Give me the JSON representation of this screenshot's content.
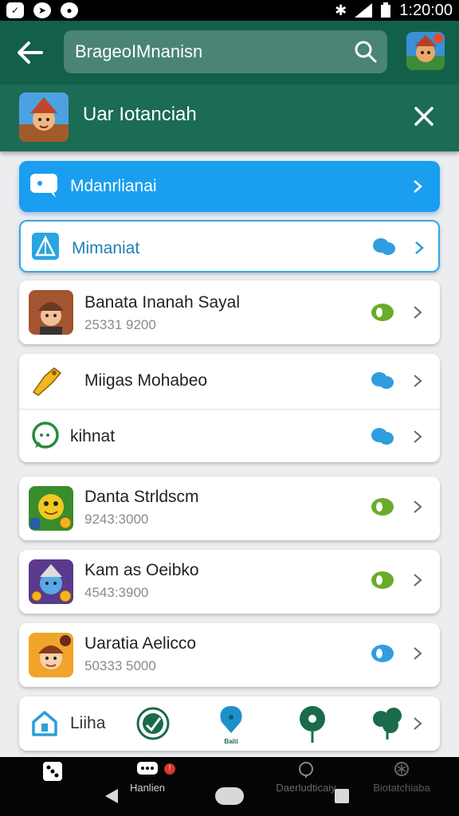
{
  "status_bar": {
    "time": "1:20:00"
  },
  "app_bar": {
    "search_text": "BrageoIMnanisn"
  },
  "sub_bar": {
    "title": "Uar Iotanciah"
  },
  "rows": [
    {
      "title": "Mdanrlianai"
    },
    {
      "title": "Mimaniat"
    },
    {
      "title": "Banata Inanah Sayal",
      "subtitle": "25331 9200"
    },
    {
      "title": "Miigas Mohabeo"
    },
    {
      "title": "kihnat"
    },
    {
      "title": "Danta Strldscm",
      "subtitle": "9243:3000"
    },
    {
      "title": "Kam as Oeibko",
      "subtitle": "4543:3900"
    },
    {
      "title": "Uaratia Aelicco",
      "subtitle": "50333 5000"
    },
    {
      "title": "Liiha"
    }
  ],
  "bottom_row_icon_caption": "Baiti",
  "bottom_nav": [
    {
      "label": "",
      "icon": "dice-icon"
    },
    {
      "label": "Hanlien",
      "icon": "chat-icon",
      "badge": "!"
    },
    {
      "label": "Daerludticaiy",
      "icon": "globe-icon"
    },
    {
      "label": "Biotatchiaba",
      "icon": "settings-icon"
    }
  ],
  "colors": {
    "app_bar": "#13604a",
    "sub_bar": "#1b6b55",
    "accent_blue": "#1a9ef0",
    "status_green": "#6bab2a",
    "status_blue": "#2f9de0"
  }
}
